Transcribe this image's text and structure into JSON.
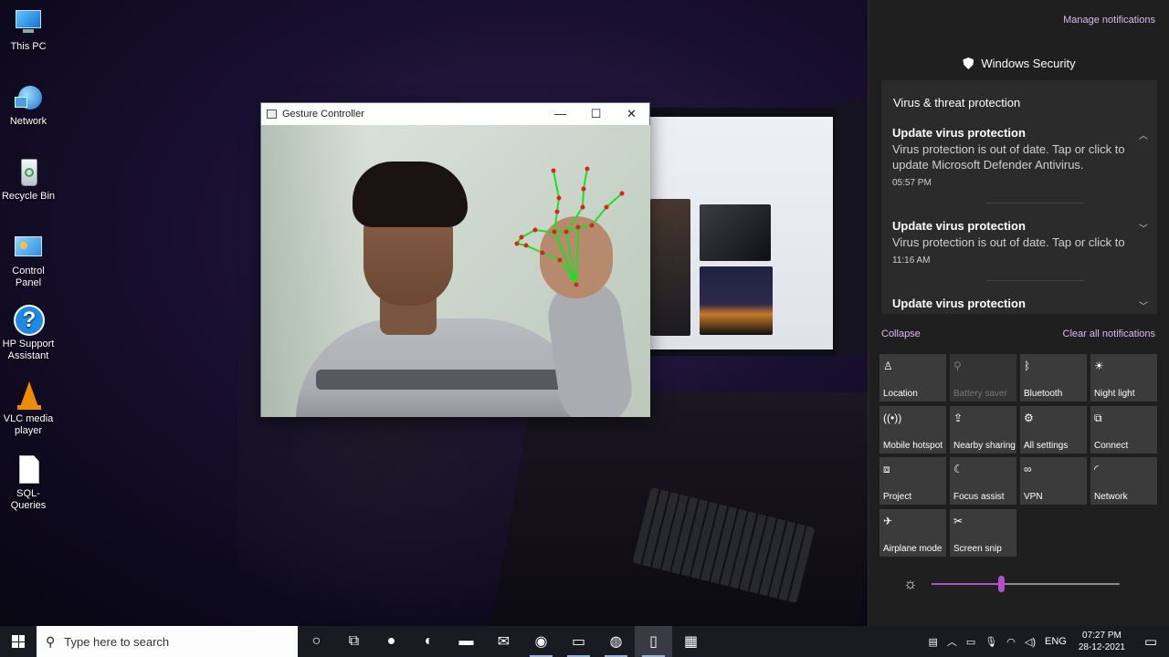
{
  "desktop": {
    "icons": [
      {
        "label": "This PC",
        "icon": "computer-icon"
      },
      {
        "label": "Network",
        "icon": "network-globe-icon"
      },
      {
        "label": "Recycle Bin",
        "icon": "recycle-bin-icon"
      },
      {
        "label": "Control Panel",
        "icon": "control-panel-icon"
      },
      {
        "label": "HP Support Assistant",
        "icon": "help-question-icon"
      },
      {
        "label": "VLC media player",
        "icon": "vlc-cone-icon"
      },
      {
        "label": "SQL-Queries",
        "icon": "document-file-icon"
      }
    ]
  },
  "gesture_window": {
    "title": "Gesture Controller",
    "controls": {
      "minimize": "—",
      "maximize": "☐",
      "close": "✕"
    }
  },
  "notification_center": {
    "manage_label": "Manage notifications",
    "group_app": "Windows Security",
    "category": "Virus & threat protection",
    "notifications": [
      {
        "title": "Update virus protection",
        "body": "Virus protection is out of date. Tap or click to update Microsoft Defender Antivirus.",
        "time": "05:57 PM",
        "expanded": true
      },
      {
        "title": "Update virus protection",
        "body": "Virus protection is out of date. Tap or click to u",
        "time": "11:16 AM",
        "expanded": false
      },
      {
        "title": "Update virus protection",
        "body": "",
        "time": "",
        "expanded": false
      }
    ],
    "collapse_label": "Collapse",
    "clear_all_label": "Clear all notifications",
    "quick_actions": [
      {
        "label": "Location",
        "icon": "location-person-icon",
        "glyph": "♙",
        "enabled": true
      },
      {
        "label": "Battery saver",
        "icon": "battery-saver-icon",
        "glyph": "⚲",
        "enabled": false
      },
      {
        "label": "Bluetooth",
        "icon": "bluetooth-icon",
        "glyph": "ᛒ",
        "enabled": true
      },
      {
        "label": "Night light",
        "icon": "night-light-icon",
        "glyph": "☀",
        "enabled": true
      },
      {
        "label": "Mobile hotspot",
        "icon": "mobile-hotspot-icon",
        "glyph": "((•))",
        "enabled": true
      },
      {
        "label": "Nearby sharing",
        "icon": "nearby-sharing-icon",
        "glyph": "⇪",
        "enabled": true
      },
      {
        "label": "All settings",
        "icon": "settings-gear-icon",
        "glyph": "⚙",
        "enabled": true
      },
      {
        "label": "Connect",
        "icon": "connect-display-icon",
        "glyph": "⧉",
        "enabled": true
      },
      {
        "label": "Project",
        "icon": "project-screen-icon",
        "glyph": "⧈",
        "enabled": true
      },
      {
        "label": "Focus assist",
        "icon": "focus-assist-moon-icon",
        "glyph": "☾",
        "enabled": true
      },
      {
        "label": "VPN",
        "icon": "vpn-icon",
        "glyph": "∞",
        "enabled": true
      },
      {
        "label": "Network",
        "icon": "network-wifi-icon",
        "glyph": "◜",
        "enabled": true
      },
      {
        "label": "Airplane mode",
        "icon": "airplane-icon",
        "glyph": "✈",
        "enabled": true
      },
      {
        "label": "Screen snip",
        "icon": "screen-snip-icon",
        "glyph": "✂",
        "enabled": true
      }
    ],
    "brightness_percent": 37
  },
  "taskbar": {
    "search_placeholder": "Type here to search",
    "apps": [
      {
        "name": "cortana-icon",
        "glyph": "○",
        "running": false
      },
      {
        "name": "task-view-icon",
        "glyph": "⧉",
        "running": false
      },
      {
        "name": "chrome-icon",
        "glyph": "●",
        "running": false
      },
      {
        "name": "edge-icon",
        "glyph": "◐",
        "running": false
      },
      {
        "name": "file-explorer-icon",
        "glyph": "▬",
        "running": false
      },
      {
        "name": "mail-icon",
        "glyph": "✉",
        "running": false
      },
      {
        "name": "chrome-profile-icon",
        "glyph": "◉",
        "running": true
      },
      {
        "name": "terminal-icon",
        "glyph": "▭",
        "running": true
      },
      {
        "name": "obs-icon",
        "glyph": "◍",
        "running": true
      },
      {
        "name": "notepad-icon",
        "glyph": "▯",
        "running": true,
        "active": true
      },
      {
        "name": "calculator-icon",
        "glyph": "▦",
        "running": false
      }
    ],
    "tray": {
      "language": "ENG",
      "time": "07:27 PM",
      "date": "28-12-2021"
    }
  },
  "colors": {
    "accent_link": "#d9b8f0",
    "slider_accent": "#b44fd1",
    "hand_landmark_line": "#22dd22",
    "hand_landmark_point": "#e02020"
  }
}
